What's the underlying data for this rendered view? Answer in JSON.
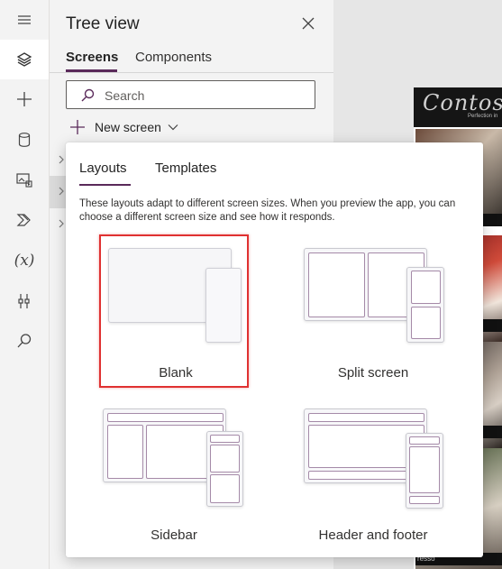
{
  "rail": {
    "items": [
      "hamburger-icon",
      "layers-icon",
      "plus-icon",
      "database-icon",
      "media-icon",
      "power-automate-icon",
      "variables-icon",
      "tools-icon",
      "search-icon"
    ],
    "variables_label": "(x)"
  },
  "tree_view": {
    "title": "Tree view",
    "tabs": [
      {
        "label": "Screens",
        "selected": true
      },
      {
        "label": "Components",
        "selected": false
      }
    ],
    "search": {
      "placeholder": "Search",
      "value": ""
    },
    "new_screen": {
      "label": "New screen"
    }
  },
  "canvas_preview": {
    "logo": "Contos",
    "tagline": "Perfection in",
    "captions": [
      "Make",
      "o Ma",
      "ee Ma",
      "resso"
    ]
  },
  "layouts_flyout": {
    "tabs": [
      {
        "label": "Layouts",
        "selected": true
      },
      {
        "label": "Templates",
        "selected": false
      }
    ],
    "description": "These layouts adapt to different screen sizes. When you preview the app, you can choose a different screen size and see how it responds.",
    "layouts": [
      {
        "label": "Blank",
        "selected": true
      },
      {
        "label": "Split screen",
        "selected": false
      },
      {
        "label": "Sidebar",
        "selected": false
      },
      {
        "label": "Header and footer",
        "selected": false
      }
    ]
  },
  "colors": {
    "accent": "#5a2a5a",
    "selection_border": "#e03131"
  }
}
